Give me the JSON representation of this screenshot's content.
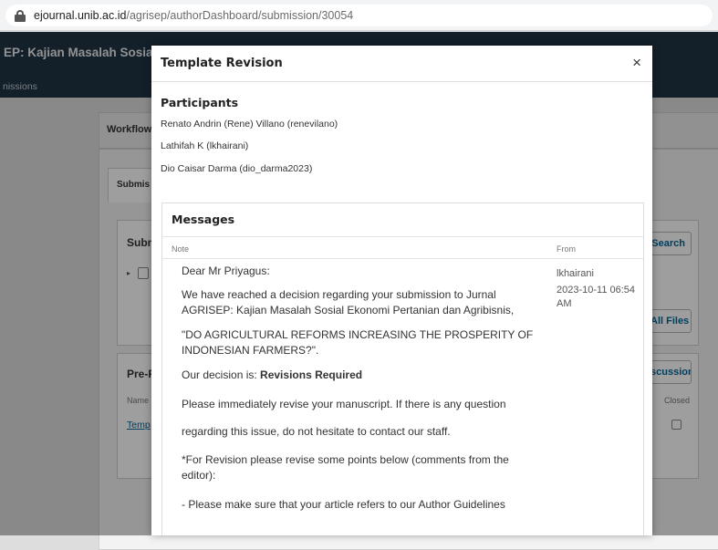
{
  "browser": {
    "url_host": "ejournal.unib.ac.id",
    "url_path": "/agrisep/authorDashboard/submission/30054"
  },
  "background": {
    "journal_title": "EP: Kajian Masalah Sosial Eko",
    "nav_item": "nissions",
    "workflow_tab": "Workflow",
    "submission_tab": "Submis",
    "files_panel_title": "Subn",
    "search_button": "Search",
    "all_files_button": "All Files",
    "pre_panel_title": "Pre-F",
    "discussion_button": "scussion",
    "name_col": "Name",
    "closed_col": "Closed",
    "discussion_link": "Temp"
  },
  "modal": {
    "title": "Template Revision",
    "close_label": "×",
    "participants_label": "Participants",
    "participants": [
      "Renato Andrin (Rene) Villano (renevilano)",
      "Lathifah K (lkhairani)",
      "Dio Caisar Darma (dio_darma2023)"
    ],
    "messages": {
      "header": "Messages",
      "col_note": "Note",
      "col_from": "From",
      "from_name": "lkhairani",
      "from_date": "2023-10-11 06:54 AM",
      "greeting": "Dear Mr Priyagus:",
      "para1": "We have reached a decision regarding your submission to Jurnal AGRISEP: Kajian Masalah Sosial Ekonomi Pertanian dan Agribisnis,",
      "para2": "\"DO AGRICULTURAL REFORMS INCREASING THE PROSPERITY OF INDONESIAN FARMERS?\".",
      "decision_prefix": "Our decision is: ",
      "decision_value": "Revisions Required",
      "para3": "Please immediately revise your manuscript. If there is any question",
      "para4": "regarding this issue, do not hesitate to contact our staff.",
      "para5": "*For Revision please revise some points below (comments from the editor):",
      "para6": "- Please make sure that your article refers to our Author Guidelines"
    }
  }
}
